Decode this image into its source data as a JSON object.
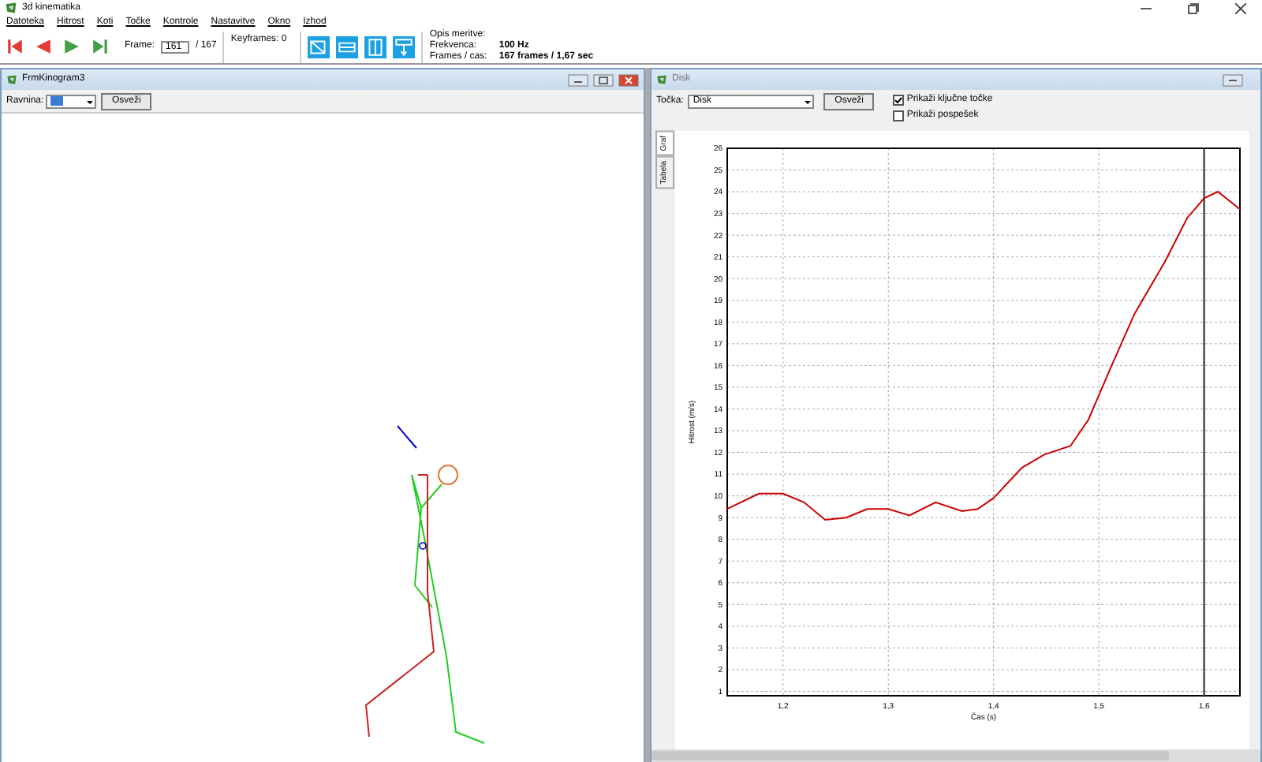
{
  "window": {
    "title": "3d kinematika"
  },
  "menu": [
    "Datoteka",
    "Hitrost",
    "Koti",
    "Točke",
    "Kontrole",
    "Nastavitve",
    "Okno",
    "Izhod"
  ],
  "toolbar": {
    "frame_label": "Frame:",
    "frame_value": "161",
    "frame_total": "/  167",
    "keyframes": "Keyframes: 0",
    "info": [
      {
        "label": "Opis meritve:"
      },
      {
        "label": "Frekvenca:",
        "value": "100 Hz"
      },
      {
        "label": "Frames / cas:",
        "value": "167 frames / 1,67 sec"
      }
    ]
  },
  "kinogram": {
    "title": "FrmKinogram3",
    "plane_label": "Ravnina:",
    "refresh": "Osveži"
  },
  "graph_window": {
    "title": "Disk",
    "point_label": "Točka:",
    "point_value": "Disk",
    "refresh": "Osveži",
    "checkboxes": [
      {
        "label": "Prikaži ključne točke",
        "checked": true
      },
      {
        "label": "Prikaži pospešek",
        "checked": false
      }
    ],
    "tabs": [
      {
        "label": "Graf",
        "selected": true
      },
      {
        "label": "Tabela",
        "selected": false
      }
    ],
    "chart_data": {
      "type": "line",
      "xlabel": "Čas (s)",
      "ylabel": "Hitrost (m/s)",
      "xlim": [
        1.147,
        1.634
      ],
      "ylim": [
        0.8,
        26
      ],
      "xticks": [
        {
          "value": 1.2,
          "label": "1,2"
        },
        {
          "value": 1.3,
          "label": "1,3"
        },
        {
          "value": 1.4,
          "label": "1,4"
        },
        {
          "value": 1.5,
          "label": "1,5"
        },
        {
          "value": 1.6,
          "label": "1,6"
        }
      ],
      "yticks": [
        1,
        2,
        3,
        4,
        5,
        6,
        7,
        8,
        9,
        10,
        11,
        12,
        13,
        14,
        15,
        16,
        17,
        18,
        19,
        20,
        21,
        22,
        23,
        24,
        25,
        26
      ],
      "x": [
        1.147,
        1.177,
        1.2,
        1.22,
        1.24,
        1.26,
        1.28,
        1.3,
        1.32,
        1.345,
        1.37,
        1.385,
        1.4,
        1.427,
        1.448,
        1.473,
        1.49,
        1.513,
        1.534,
        1.563,
        1.584,
        1.6,
        1.613,
        1.634
      ],
      "grid": true,
      "series": [
        {
          "color": "#cc0000",
          "values": [
            9.4,
            10.1,
            10.1,
            9.7,
            8.9,
            9.0,
            9.4,
            9.4,
            9.1,
            9.7,
            9.3,
            9.4,
            9.9,
            11.3,
            11.9,
            12.3,
            13.5,
            16.1,
            18.4,
            20.8,
            22.8,
            23.7,
            24.0,
            23.2
          ]
        }
      ],
      "ref_lines": [
        {
          "axis": "x",
          "value": 1.6
        }
      ]
    }
  }
}
